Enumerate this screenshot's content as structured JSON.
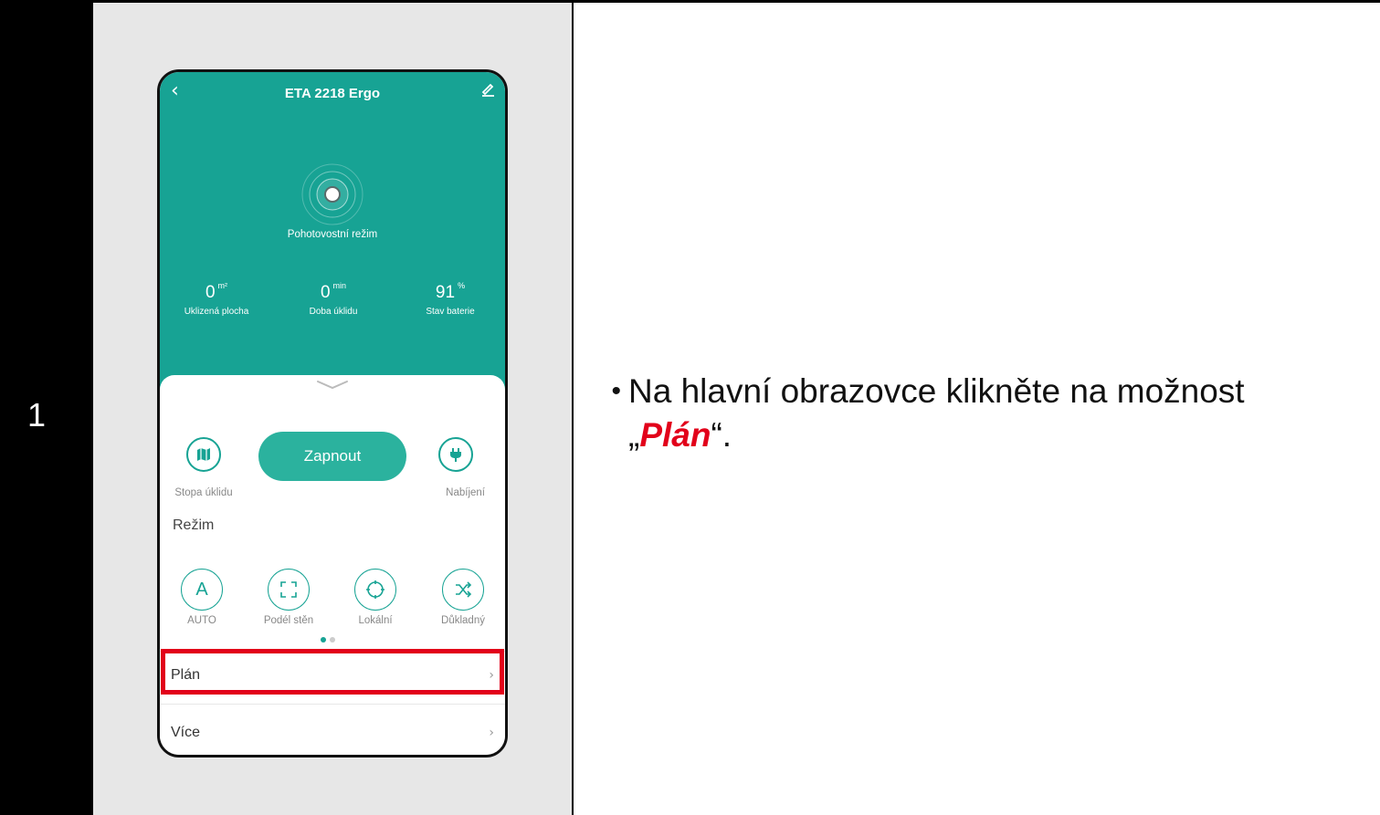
{
  "step": {
    "number": "1"
  },
  "instruction": {
    "bullet": "•",
    "text_before": "Na hlavní obrazovce klikněte na možnost",
    "quote_open": "„",
    "highlight": "Plán",
    "quote_close": "“."
  },
  "phone": {
    "header": {
      "title": "ETA 2218 Ergo"
    },
    "status": "Pohotovostní režim",
    "stats": [
      {
        "value": "0",
        "unit": "m²",
        "label": "Uklizená plocha"
      },
      {
        "value": "0",
        "unit": "min",
        "label": "Doba úklidu"
      },
      {
        "value": "91",
        "unit": "%",
        "label": "Stav baterie"
      }
    ],
    "controls": {
      "map_label": "Stopa úklidu",
      "start_label": "Zapnout",
      "charge_label": "Nabíjení"
    },
    "mode": {
      "title": "Režim",
      "items": [
        {
          "label": "AUTO",
          "icon": "auto-mode-icon"
        },
        {
          "label": "Podél stěn",
          "icon": "edge-mode-icon"
        },
        {
          "label": "Lokální",
          "icon": "spot-mode-icon"
        },
        {
          "label": "Důkladný",
          "icon": "random-mode-icon"
        }
      ]
    },
    "menu": [
      {
        "label": "Plán"
      },
      {
        "label": "Více"
      }
    ],
    "colors": {
      "accent": "#17a394",
      "button": "#2bb29e",
      "highlight": "#e2001a"
    }
  }
}
